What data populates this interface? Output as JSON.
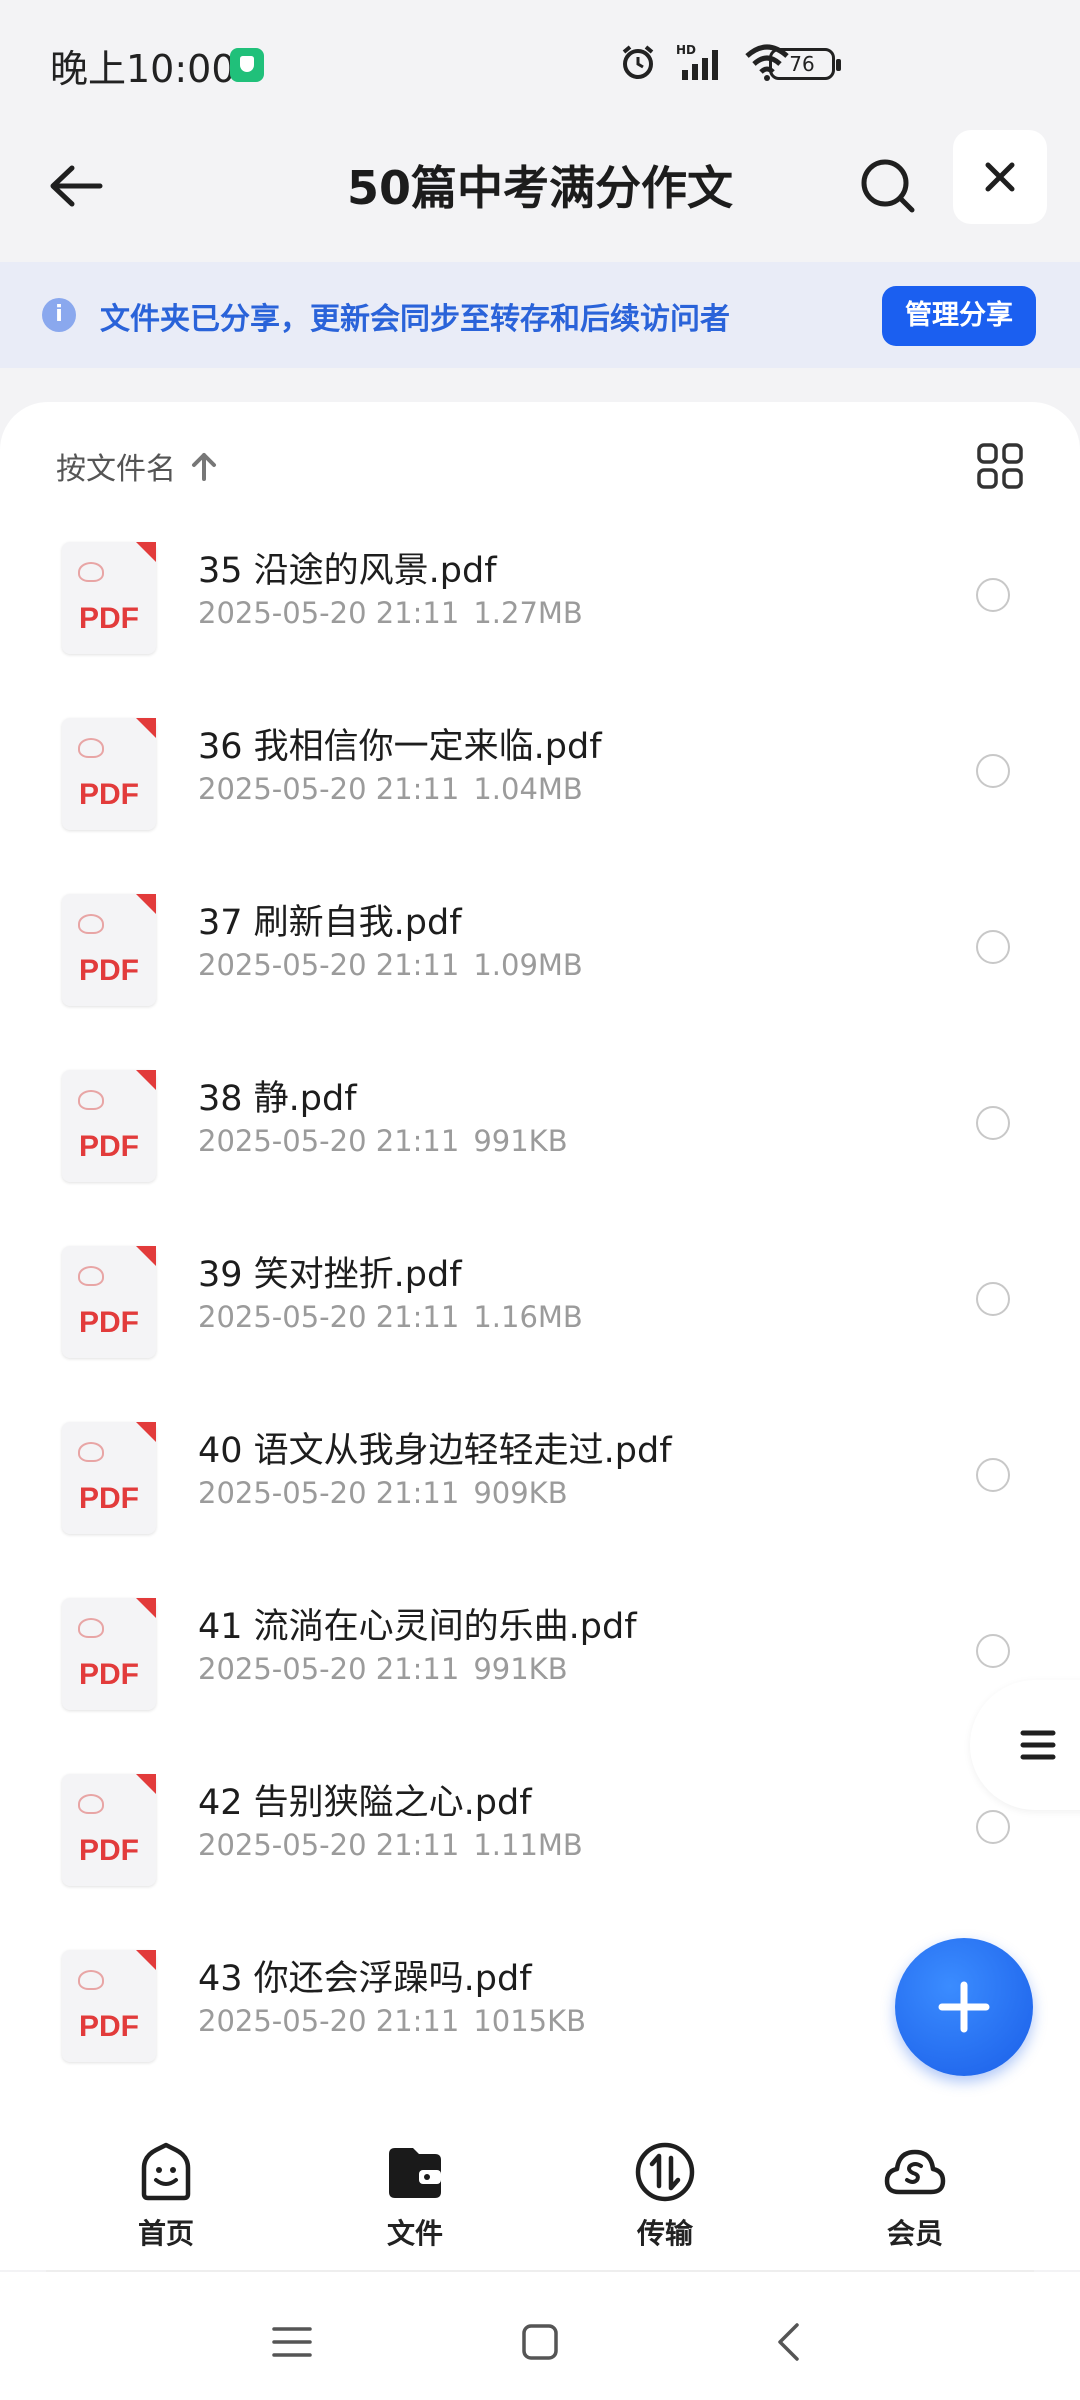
{
  "status_bar": {
    "time": "晚上10:00",
    "battery": "76",
    "network_label": "HD"
  },
  "header": {
    "title": "50篇中考满分作文"
  },
  "share_banner": {
    "text": "文件夹已分享，更新会同步至转存和后续访问者",
    "button_label": "管理分享"
  },
  "sort": {
    "label": "按文件名"
  },
  "file_type_label": "PDF",
  "files": [
    {
      "name": "35 沿途的风景.pdf",
      "date": "2025-05-20 21:11",
      "size": "1.27MB"
    },
    {
      "name": "36 我相信你一定来临.pdf",
      "date": "2025-05-20 21:11",
      "size": "1.04MB"
    },
    {
      "name": "37 刷新自我.pdf",
      "date": "2025-05-20 21:11",
      "size": "1.09MB"
    },
    {
      "name": "38 静.pdf",
      "date": "2025-05-20 21:11",
      "size": "991KB"
    },
    {
      "name": "39 笑对挫折.pdf",
      "date": "2025-05-20 21:11",
      "size": "1.16MB"
    },
    {
      "name": "40 语文从我身边轻轻走过.pdf",
      "date": "2025-05-20 21:11",
      "size": "909KB"
    },
    {
      "name": "41 流淌在心灵间的乐曲.pdf",
      "date": "2025-05-20 21:11",
      "size": "991KB"
    },
    {
      "name": "42 告别狭隘之心.pdf",
      "date": "2025-05-20 21:11",
      "size": "1.11MB"
    },
    {
      "name": "43 你还会浮躁吗.pdf",
      "date": "2025-05-20 21:11",
      "size": "1015KB"
    }
  ],
  "bottom_nav": [
    {
      "label": "首页",
      "icon": "home-smile-icon"
    },
    {
      "label": "文件",
      "icon": "wallet-file-icon"
    },
    {
      "label": "传输",
      "icon": "transfer-icon"
    },
    {
      "label": "会员",
      "icon": "vip-cloud-icon"
    }
  ],
  "colors": {
    "accent": "#1b5ff0",
    "pdf_red": "#e23b3b",
    "banner_bg": "#e9ecf7"
  }
}
